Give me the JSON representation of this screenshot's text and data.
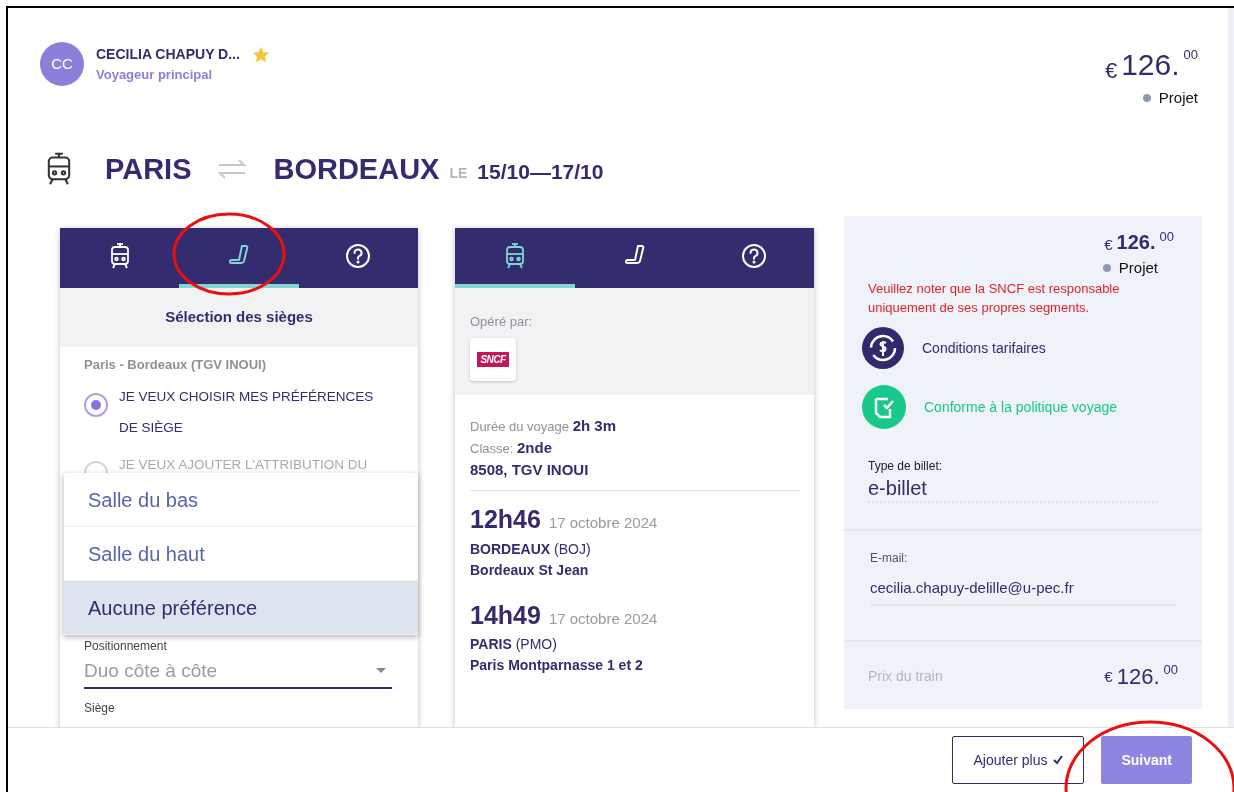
{
  "traveler": {
    "initials": "CC",
    "name": "CECILIA CHAPUY D...",
    "role": "Voyageur principal",
    "starred": true
  },
  "header_price": {
    "currency": "€",
    "amount": "126.",
    "cents": "00",
    "status": {
      "label": "Projet",
      "color": "#8e9ab5"
    }
  },
  "route": {
    "from": "PARIS",
    "to": "BORDEAUX",
    "date_prefix": "LE",
    "dates": "15/10—17/10"
  },
  "seat_card": {
    "tabs": [
      {
        "kind": "train",
        "selected": false
      },
      {
        "kind": "seat",
        "selected": true
      },
      {
        "kind": "help",
        "selected": false
      }
    ],
    "title": "Sélection des sièges",
    "segment": "Paris - Bordeaux (TGV INOUI)",
    "options": [
      {
        "label": "JE VEUX CHOISIR MES PRÉFÉRENCES DE SIÈGE",
        "selected": true,
        "disabled": false
      },
      {
        "label": "JE VEUX AJOUTER L'ATTRIBUTION DU",
        "selected": false,
        "disabled": true
      }
    ],
    "dropdown": [
      {
        "label": "Salle du bas",
        "selected": false
      },
      {
        "label": "Salle du haut",
        "selected": false
      },
      {
        "label": "Aucune préférence",
        "selected": true
      }
    ],
    "positioning": {
      "label": "Positionnement",
      "value": "Duo côte à côte"
    },
    "seat_label": "Siège"
  },
  "train_card": {
    "tabs": [
      {
        "kind": "train",
        "selected": true
      },
      {
        "kind": "seat",
        "selected": false
      },
      {
        "kind": "help",
        "selected": false
      }
    ],
    "operator_label": "Opéré par:",
    "operator_logo": "SNCF",
    "duration_label": "Durée du voyage",
    "duration": "2h 3m",
    "class_label": "Classe:",
    "class": "2nde",
    "train": "8508, TGV INOUI",
    "stops": [
      {
        "time": "12h46",
        "date": "17 octobre 2024",
        "city": "BORDEAUX",
        "code": "(BOJ)",
        "station": "Bordeaux St Jean"
      },
      {
        "time": "14h49",
        "date": "17 octobre 2024",
        "city": "PARIS",
        "code": "(PMO)",
        "station": "Paris Montparnasse 1 et 2"
      }
    ]
  },
  "summary": {
    "currency": "€",
    "amount": "126.",
    "cents": "00",
    "status": {
      "label": "Projet",
      "color": "#8e9ab5"
    },
    "notice": "Veuillez noter que la SNCF est responsable uniquement de ses propres segments.",
    "links": [
      {
        "kind": "fare",
        "label": "Conditions tarifaires"
      },
      {
        "kind": "policy",
        "label": "Conforme à la politique voyage"
      }
    ],
    "ticket_type": {
      "label": "Type de billet:",
      "value": "e-billet"
    },
    "email": {
      "label": "E-mail:",
      "value": "cecilia.chapuy-delille@u-pec.fr"
    },
    "train_price": {
      "label": "Prix du train",
      "currency": "€",
      "amount": "126.",
      "cents": "00"
    }
  },
  "footer_buttons": [
    {
      "label": "Ajouter plus",
      "kind": "outline"
    },
    {
      "label": "Suivant",
      "kind": "primary"
    }
  ]
}
